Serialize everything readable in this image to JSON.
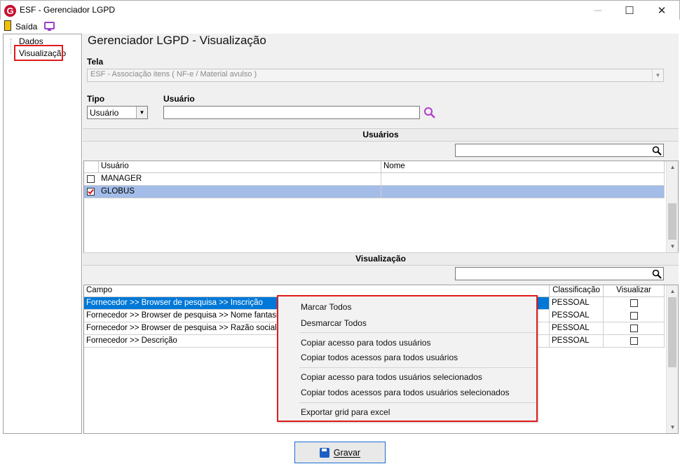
{
  "window": {
    "title": "ESF - Gerenciador LGPD",
    "app_icon": "G",
    "minimize": "—",
    "maximize": "☐",
    "close": "✕"
  },
  "toolbar": {
    "exit_label": "Saída"
  },
  "tree": {
    "items": [
      {
        "label": "Dados"
      },
      {
        "label": "Visualização"
      }
    ]
  },
  "page_title": "Gerenciador LGPD - Visualização",
  "tela": {
    "label": "Tela",
    "value": "ESF - Associação itens ( NF-e / Material avulso )"
  },
  "tipo": {
    "label": "Tipo",
    "value": "Usuário"
  },
  "usuario": {
    "label": "Usuário",
    "value": ""
  },
  "users_section": {
    "title": "Usuários",
    "columns": [
      "Usuário",
      "Nome"
    ],
    "rows": [
      {
        "usuario": "MANAGER",
        "nome": "",
        "checked": false
      },
      {
        "usuario": "GLOBUS",
        "nome": "",
        "checked": true
      }
    ]
  },
  "visualizacao_section": {
    "title": "Visualização",
    "columns": [
      "Campo",
      "Classificação",
      "Visualizar"
    ],
    "rows": [
      {
        "campo": "Fornecedor >> Browser de pesquisa >> Inscrição",
        "classificacao": "PESSOAL",
        "visualizar": false
      },
      {
        "campo": "Fornecedor >> Browser de pesquisa >> Nome fantasia",
        "classificacao": "PESSOAL",
        "visualizar": false
      },
      {
        "campo": "Fornecedor >> Browser de pesquisa >> Razão social",
        "classificacao": "PESSOAL",
        "visualizar": false
      },
      {
        "campo": "Fornecedor >> Descrição",
        "classificacao": "PESSOAL",
        "visualizar": false
      }
    ]
  },
  "context_menu": {
    "items": [
      "Marcar Todos",
      "Desmarcar Todos",
      "Copiar acesso para todos usuários",
      "Copiar todos acessos para todos usuários",
      "Copiar acesso para todos usuários selecionados",
      "Copiar todos acessos para todos usuários selecionados",
      "Exportar grid para excel"
    ]
  },
  "footer": {
    "save_label": "Gravar"
  },
  "colors": {
    "accent": "#1a6dd6",
    "selected_row": "#a3bde8",
    "highlight_row": "#0078d7",
    "annotation": "#e11b1b"
  }
}
